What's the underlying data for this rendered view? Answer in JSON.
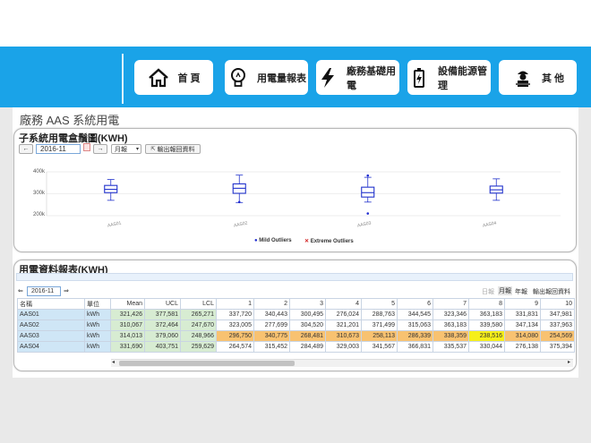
{
  "nav": {
    "items": [
      {
        "label": "首 頁",
        "icon": "home-icon"
      },
      {
        "label": "用電量報表",
        "icon": "lightbulb-icon"
      },
      {
        "label": "廠務基礎用電",
        "icon": "lightning-icon"
      },
      {
        "label": "設備能源管理",
        "icon": "battery-icon"
      },
      {
        "label": "其 他",
        "icon": "worker-icon"
      }
    ]
  },
  "page": {
    "title": "廠務 AAS 系統用電"
  },
  "chart_panel": {
    "title": "子系統用電盒鬚圖(KWH)",
    "prev": "←",
    "date": "2016-11",
    "next": "→",
    "period": "月報",
    "export": "輸出報回資料"
  },
  "chart_data": {
    "type": "box",
    "categories": [
      "AAS01",
      "AAS02",
      "AAS03",
      "AAS04"
    ],
    "yticks": [
      "400k",
      "300k",
      "200k"
    ],
    "ylim": [
      200000,
      400000
    ],
    "series": [
      {
        "name": "AAS01",
        "min": 270000,
        "q1": 305000,
        "median": 320000,
        "q3": 338000,
        "max": 365000,
        "outliers": []
      },
      {
        "name": "AAS02",
        "min": 260000,
        "q1": 302000,
        "median": 325000,
        "q3": 345000,
        "max": 385000,
        "outliers": [
          262000
        ]
      },
      {
        "name": "AAS03",
        "min": 262000,
        "q1": 285000,
        "median": 305000,
        "q3": 330000,
        "max": 375000,
        "outliers": [
          383000,
          210000
        ]
      },
      {
        "name": "AAS04",
        "min": 270000,
        "q1": 303000,
        "median": 318000,
        "q3": 335000,
        "max": 368000,
        "outliers": []
      }
    ],
    "legend": [
      "Mild Outliers",
      "Extreme Outliers"
    ],
    "grid": true
  },
  "table_panel": {
    "title": "用電資料報表(KWH)",
    "date": "2016-11",
    "tools": [
      "日報",
      "月報",
      "年報",
      "輸出報回資料"
    ],
    "columns": [
      "名稱",
      "單位",
      "Mean",
      "UCL",
      "LCL",
      "1",
      "2",
      "3",
      "4",
      "5",
      "6",
      "7",
      "8",
      "9",
      "10"
    ],
    "rows": [
      {
        "cells": [
          "AAS01",
          "kWh",
          "321,426",
          "377,581",
          "265,271",
          "337,720",
          "340,443",
          "300,495",
          "276,024",
          "288,763",
          "344,545",
          "323,346",
          "363,183",
          "331,831",
          "347,981"
        ]
      },
      {
        "cells": [
          "AAS02",
          "kWh",
          "310,067",
          "372,464",
          "247,670",
          "323,005",
          "277,699",
          "304,520",
          "321,201",
          "371,499",
          "315,063",
          "363,183",
          "339,580",
          "347,134",
          "337,963"
        ]
      },
      {
        "cells": [
          "AAS03",
          "kWh",
          "314,013",
          "379,060",
          "248,966",
          "296,750",
          "340,775",
          "268,481",
          "310,673",
          "258,113",
          "286,339",
          "338,359",
          "238,516",
          "314,080",
          "254,569"
        ]
      },
      {
        "cells": [
          "AAS04",
          "kWh",
          "331,690",
          "403,751",
          "259,629",
          "264,574",
          "315,452",
          "284,489",
          "329,003",
          "341,567",
          "366,831",
          "335,537",
          "330,044",
          "276,138",
          "375,394"
        ]
      }
    ]
  },
  "colors": {
    "header": "#1aa3e8",
    "box": "#2233cc",
    "mild": "#1f2bd1",
    "extreme": "#d22222"
  }
}
